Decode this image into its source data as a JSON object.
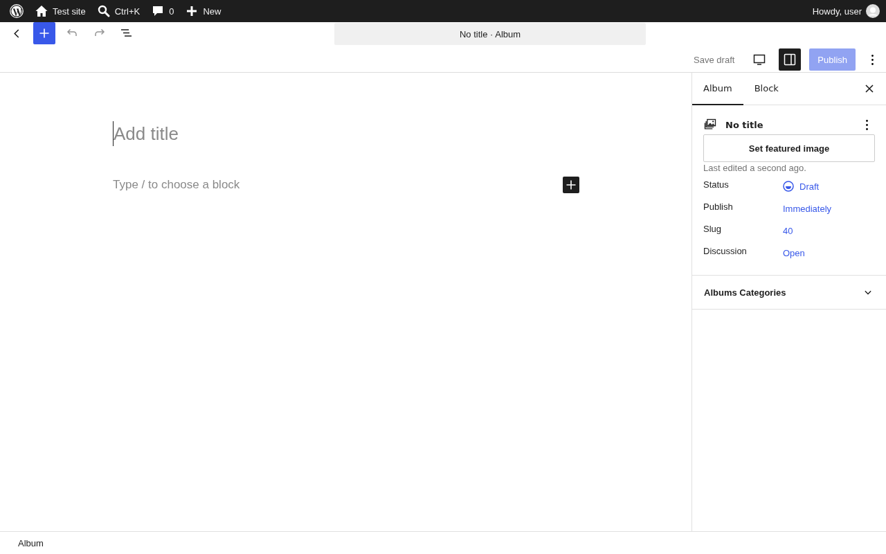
{
  "admin_bar": {
    "items": [
      {
        "kind": "logo"
      },
      {
        "kind": "home",
        "label": "Test site"
      },
      {
        "kind": "search",
        "label": "Ctrl+K"
      },
      {
        "kind": "comments",
        "label": "0"
      },
      {
        "kind": "new",
        "label": "New"
      }
    ],
    "greeting": "Howdy, user"
  },
  "toolbar": {
    "undo_disabled": true,
    "redo_disabled": true,
    "document_title": "No title · Album",
    "save_draft": "Save draft",
    "publish": "Publish",
    "settings_open": true
  },
  "editor": {
    "title_placeholder": "Add title",
    "block_placeholder": "Type / to choose a block"
  },
  "sidebar": {
    "tabs": [
      {
        "label": "Album",
        "selected": true
      },
      {
        "label": "Block",
        "selected": false
      }
    ],
    "post_title": "No title",
    "featured_image_button": "Set featured image",
    "last_edited": "Last edited a second ago.",
    "fields": [
      {
        "kind": "status",
        "label": "Status",
        "value": "Draft"
      },
      {
        "kind": "link",
        "label": "Publish",
        "value": "Immediately"
      },
      {
        "kind": "link",
        "label": "Slug",
        "value": "40"
      },
      {
        "kind": "link",
        "label": "Discussion",
        "value": "Open"
      }
    ],
    "panels": [
      {
        "title": "Albums Categories",
        "expanded": false
      }
    ]
  },
  "breadcrumb": "Album"
}
